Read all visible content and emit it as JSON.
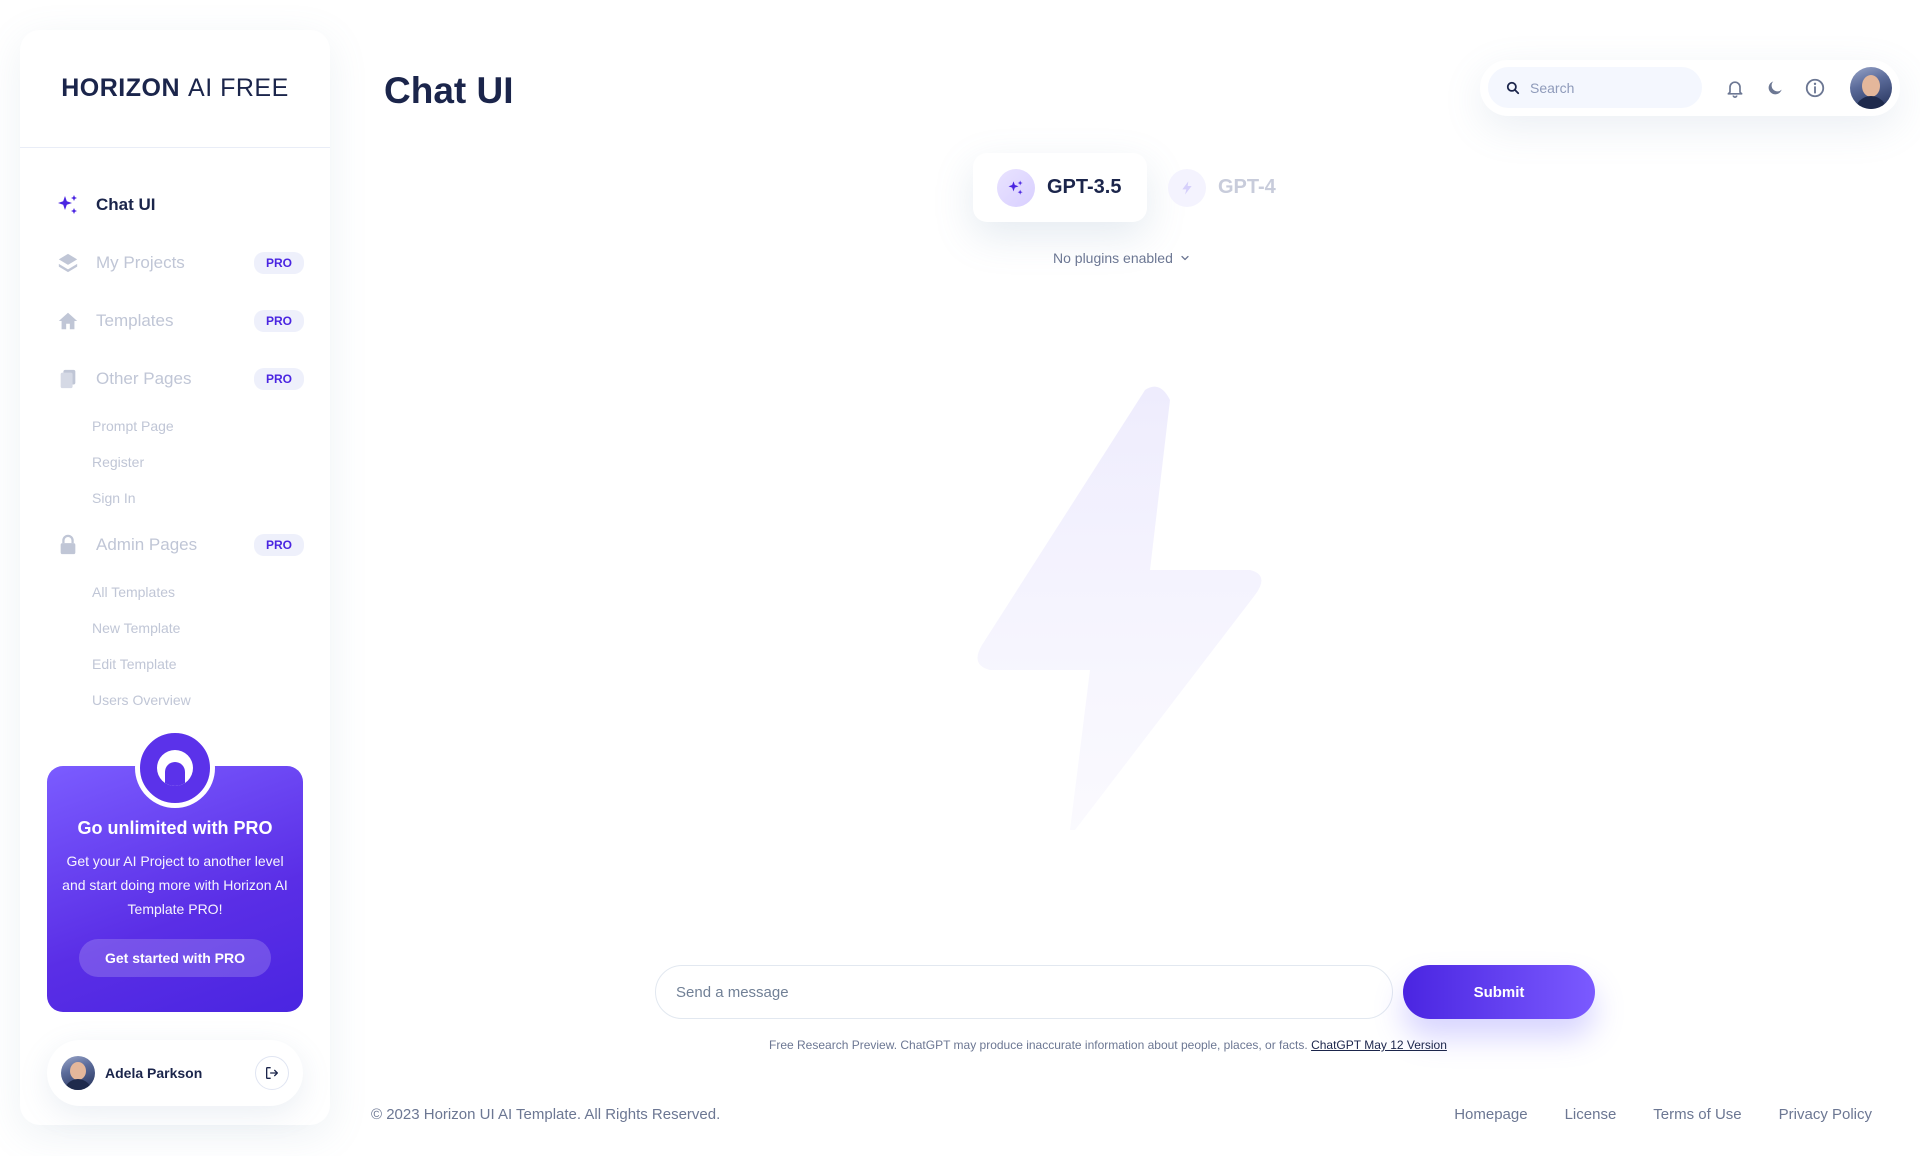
{
  "brand": {
    "bold": "HORIZON",
    "rest": "AI FREE"
  },
  "page_title": "Chat UI",
  "sidebar": {
    "items": [
      {
        "label": "Chat UI",
        "icon": "sparkles-icon",
        "active": true
      },
      {
        "label": "My Projects",
        "icon": "layers-icon",
        "badge": "PRO"
      },
      {
        "label": "Templates",
        "icon": "home-icon",
        "badge": "PRO"
      },
      {
        "label": "Other Pages",
        "icon": "document-icon",
        "badge": "PRO",
        "children": [
          "Prompt Page",
          "Register",
          "Sign In"
        ]
      },
      {
        "label": "Admin Pages",
        "icon": "lock-icon",
        "badge": "PRO",
        "children": [
          "All Templates",
          "New Template",
          "Edit Template",
          "Users Overview"
        ]
      }
    ]
  },
  "promo": {
    "title": "Go unlimited with PRO",
    "text": "Get your AI Project to another level and start doing more with Horizon AI Template PRO!",
    "button": "Get started with PRO"
  },
  "user": {
    "name": "Adela Parkson"
  },
  "header": {
    "search_placeholder": "Search"
  },
  "models": {
    "active": "GPT-3.5",
    "inactive": "GPT-4",
    "plugins": "No plugins enabled"
  },
  "composer": {
    "placeholder": "Send a message",
    "submit": "Submit",
    "disclaimer": "Free Research Preview. ChatGPT may produce inaccurate information about people, places, or facts.",
    "disclaimer_link": "ChatGPT May 12 Version"
  },
  "footer": {
    "copyright": "© 2023 Horizon UI AI Template. All Rights Reserved.",
    "links": [
      "Homepage",
      "License",
      "Terms of Use",
      "Privacy Policy"
    ]
  },
  "colors": {
    "accent": "#4a25e1",
    "accent_light": "#7b5aff",
    "text": "#1b254b",
    "muted": "#c0c6d6"
  }
}
